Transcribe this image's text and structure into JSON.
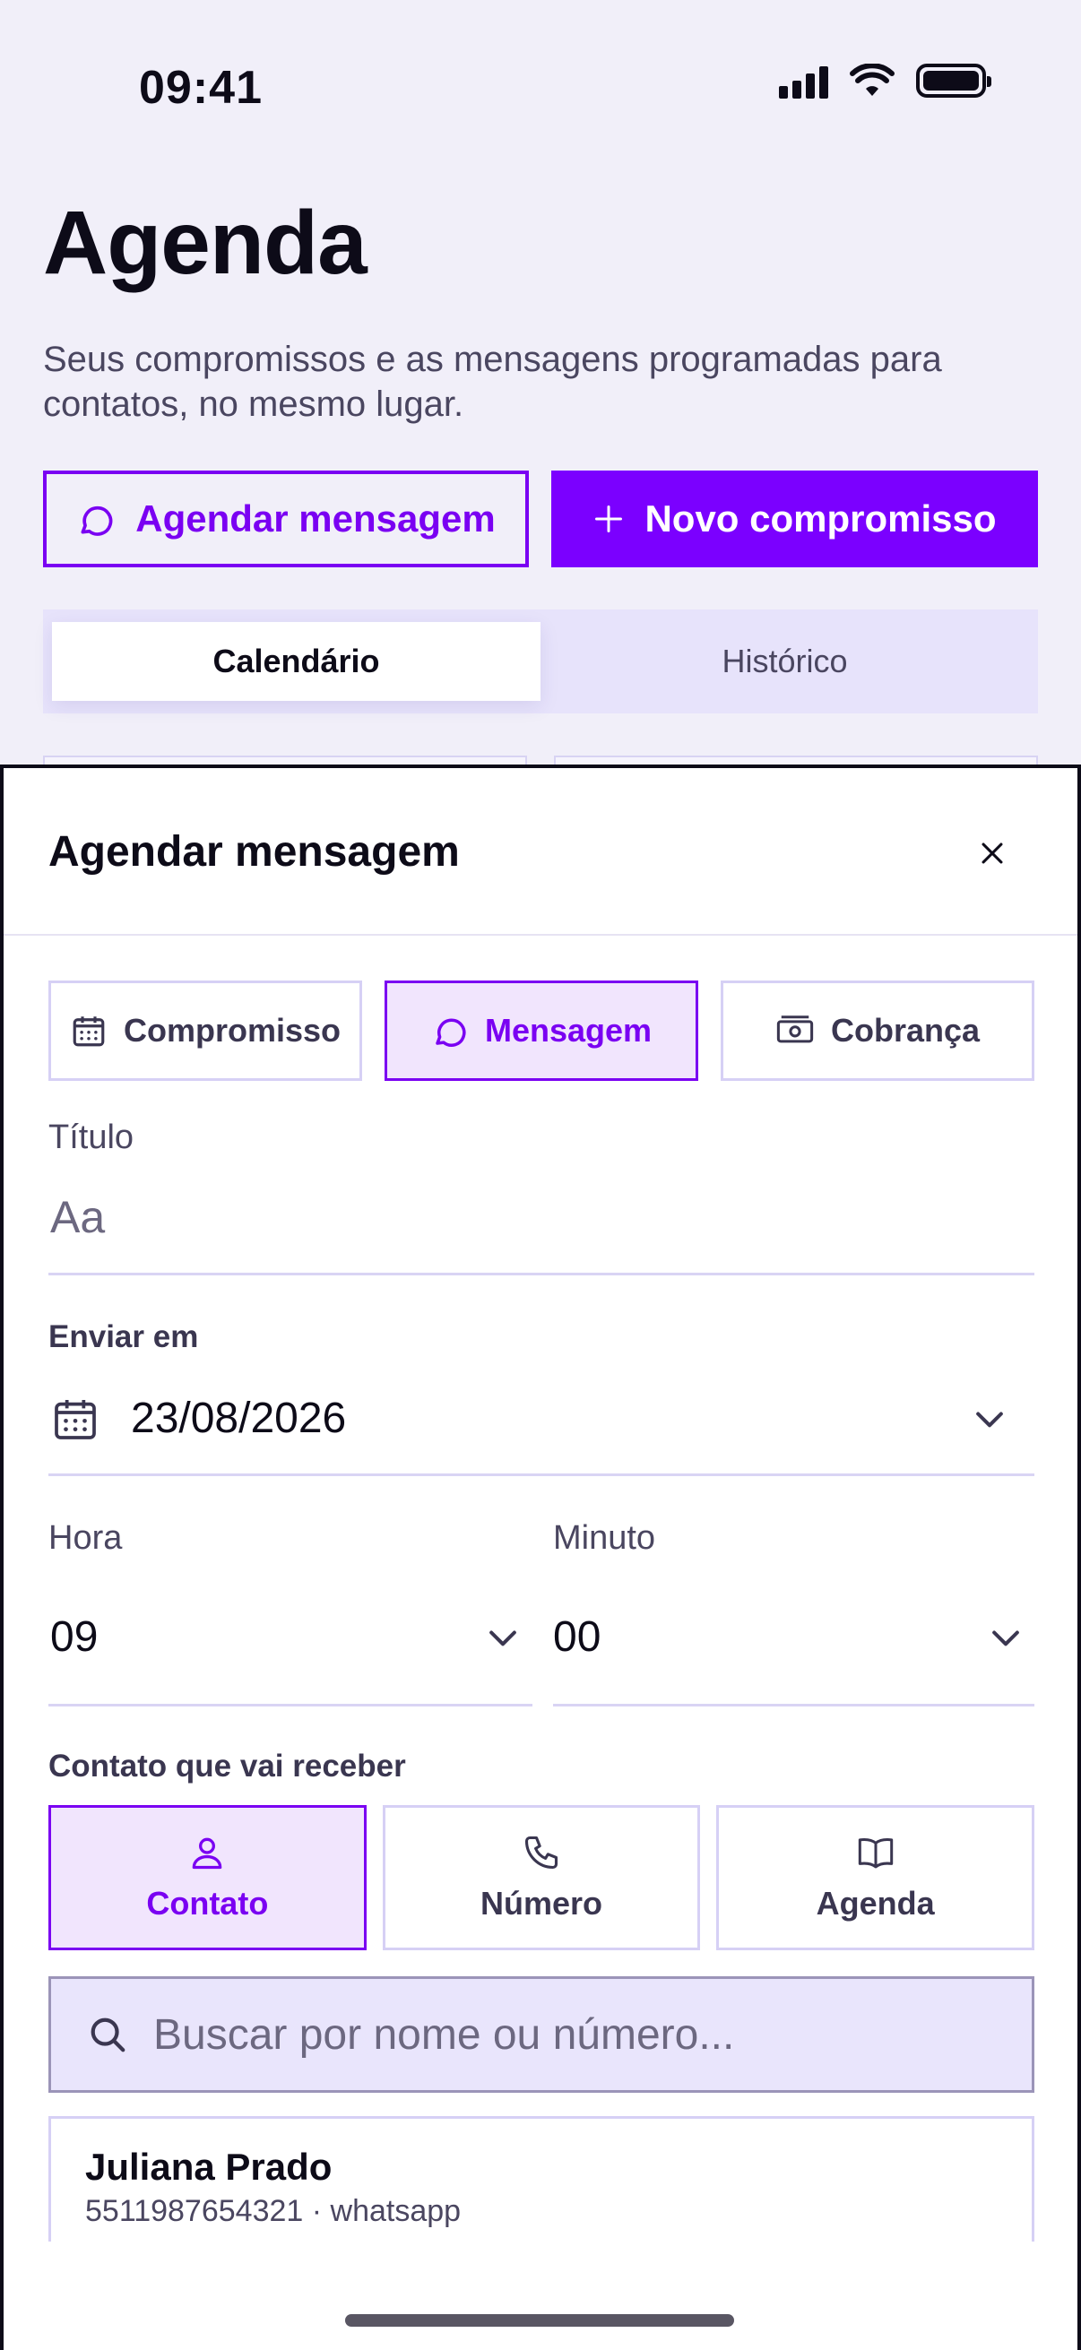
{
  "status_bar": {
    "time": "09:41"
  },
  "header": {
    "title": "Agenda",
    "subtitle": "Seus compromissos e as mensagens programadas para contatos, no mesmo lugar.",
    "schedule_message_label": "Agendar mensagem",
    "new_appointment_label": "Novo compromisso"
  },
  "tabs": [
    {
      "label": "Calendário",
      "active": true
    },
    {
      "label": "Histórico",
      "active": false
    }
  ],
  "sheet": {
    "title": "Agendar mensagem",
    "types": [
      {
        "label": "Compromisso",
        "icon": "calendar-icon",
        "active": false
      },
      {
        "label": "Mensagem",
        "icon": "chat-bubble-icon",
        "active": true
      },
      {
        "label": "Cobrança",
        "icon": "banknote-icon",
        "active": false
      }
    ],
    "title_field": {
      "label": "Título",
      "placeholder": "Aa",
      "value": ""
    },
    "send_date": {
      "label": "Enviar em",
      "value": "23/08/2026"
    },
    "hour": {
      "label": "Hora",
      "value": "09"
    },
    "minute": {
      "label": "Minuto",
      "value": "00"
    },
    "recipient": {
      "label": "Contato que vai receber",
      "options": [
        {
          "label": "Contato",
          "icon": "person-icon",
          "active": true
        },
        {
          "label": "Número",
          "icon": "phone-icon",
          "active": false
        },
        {
          "label": "Agenda",
          "icon": "book-icon",
          "active": false
        }
      ]
    },
    "search": {
      "placeholder": "Buscar por nome ou número..."
    },
    "contacts": [
      {
        "name": "Juliana Prado",
        "detail": "5511987654321 · whatsapp"
      }
    ]
  },
  "colors": {
    "accent": "#7b00ff",
    "background": "#f1eff9",
    "tab_track": "#e7e3fb"
  }
}
